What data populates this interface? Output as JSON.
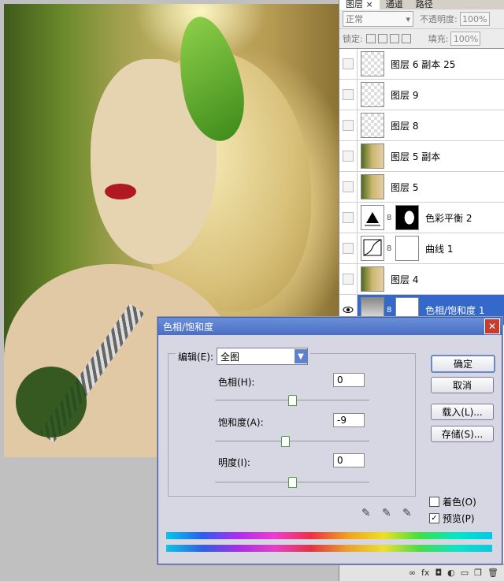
{
  "panel": {
    "tabs": [
      "图层 ×",
      "通道",
      "路径"
    ],
    "blend_mode": "正常",
    "opacity_label": "不透明度:",
    "opacity_value": "100%",
    "lock_label": "锁定:",
    "fill_label": "填充:",
    "fill_value": "100%",
    "layers": [
      {
        "name": "图层 6 副本 25",
        "thumb": "transparent",
        "selected": false,
        "visible": false
      },
      {
        "name": "图层 9",
        "thumb": "transparent",
        "selected": false,
        "visible": false
      },
      {
        "name": "图层 8",
        "thumb": "transparent",
        "selected": false,
        "visible": false
      },
      {
        "name": "图层 5 副本",
        "thumb": "image",
        "selected": false,
        "visible": false
      },
      {
        "name": "图层 5",
        "thumb": "image",
        "selected": false,
        "visible": false
      },
      {
        "name": "色彩平衡 2",
        "thumb": "adjustment",
        "selected": false,
        "visible": false
      },
      {
        "name": "曲线 1",
        "thumb": "adjustment",
        "selected": false,
        "visible": false
      },
      {
        "name": "图层 4",
        "thumb": "image",
        "selected": false,
        "visible": false
      },
      {
        "name": "色相/饱和度 1",
        "thumb": "adjustment",
        "selected": true,
        "visible": true
      }
    ]
  },
  "dialog": {
    "title": "色相/饱和度",
    "edit_label": "编辑(E):",
    "edit_value": "全图",
    "hue_label": "色相(H):",
    "hue_value": "0",
    "saturation_label": "饱和度(A):",
    "saturation_value": "-9",
    "lightness_label": "明度(I):",
    "lightness_value": "0",
    "ok_label": "确定",
    "cancel_label": "取消",
    "load_label": "载入(L)...",
    "save_label": "存储(S)...",
    "colorize_label": "着色(O)",
    "preview_label": "预览(P)",
    "colorize_checked": false,
    "preview_checked": true
  }
}
